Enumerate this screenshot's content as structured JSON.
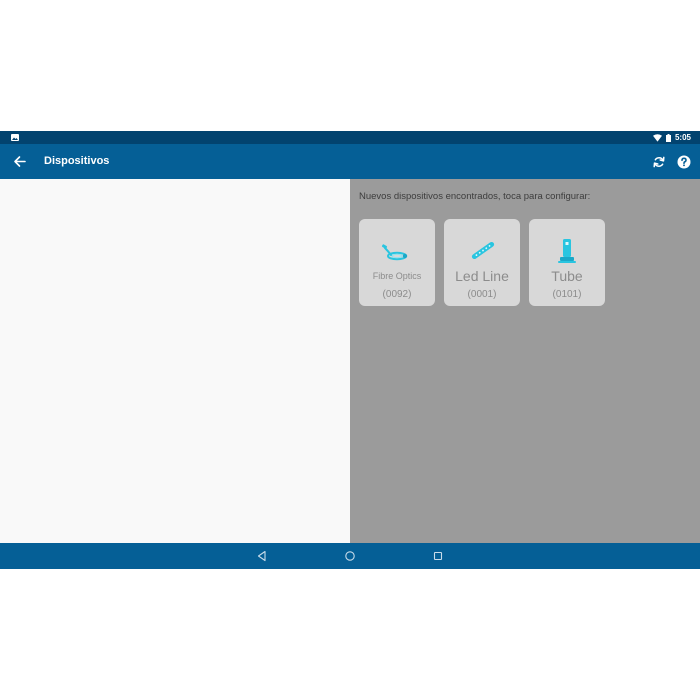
{
  "status_bar": {
    "time": "5:05",
    "icons": [
      "image-notification-icon",
      "wifi-icon",
      "battery-icon"
    ]
  },
  "app_bar": {
    "title": "Dispositivos",
    "icons": [
      "back-arrow-icon",
      "refresh-icon",
      "help-icon"
    ]
  },
  "main": {
    "prompt": "Nuevos dispositivos encontrados, toca para configurar:",
    "devices": [
      {
        "name": "Fibre Optics",
        "code": "(0092)",
        "icon": "fibre-optics-icon"
      },
      {
        "name": "Led Line",
        "code": "(0001)",
        "icon": "led-line-icon"
      },
      {
        "name": "Tube",
        "code": "(0101)",
        "icon": "tube-icon"
      }
    ]
  },
  "nav_bar": {
    "icons": [
      "back-triangle-icon",
      "home-circle-icon",
      "recents-square-icon"
    ]
  },
  "colors": {
    "status_bar": "#02436f",
    "app_bar": "#055f96",
    "left_pane": "#f9f9f9",
    "right_pane": "#9b9b9b",
    "card": "#d8d8d8",
    "device_icon": "#29c5e0"
  }
}
